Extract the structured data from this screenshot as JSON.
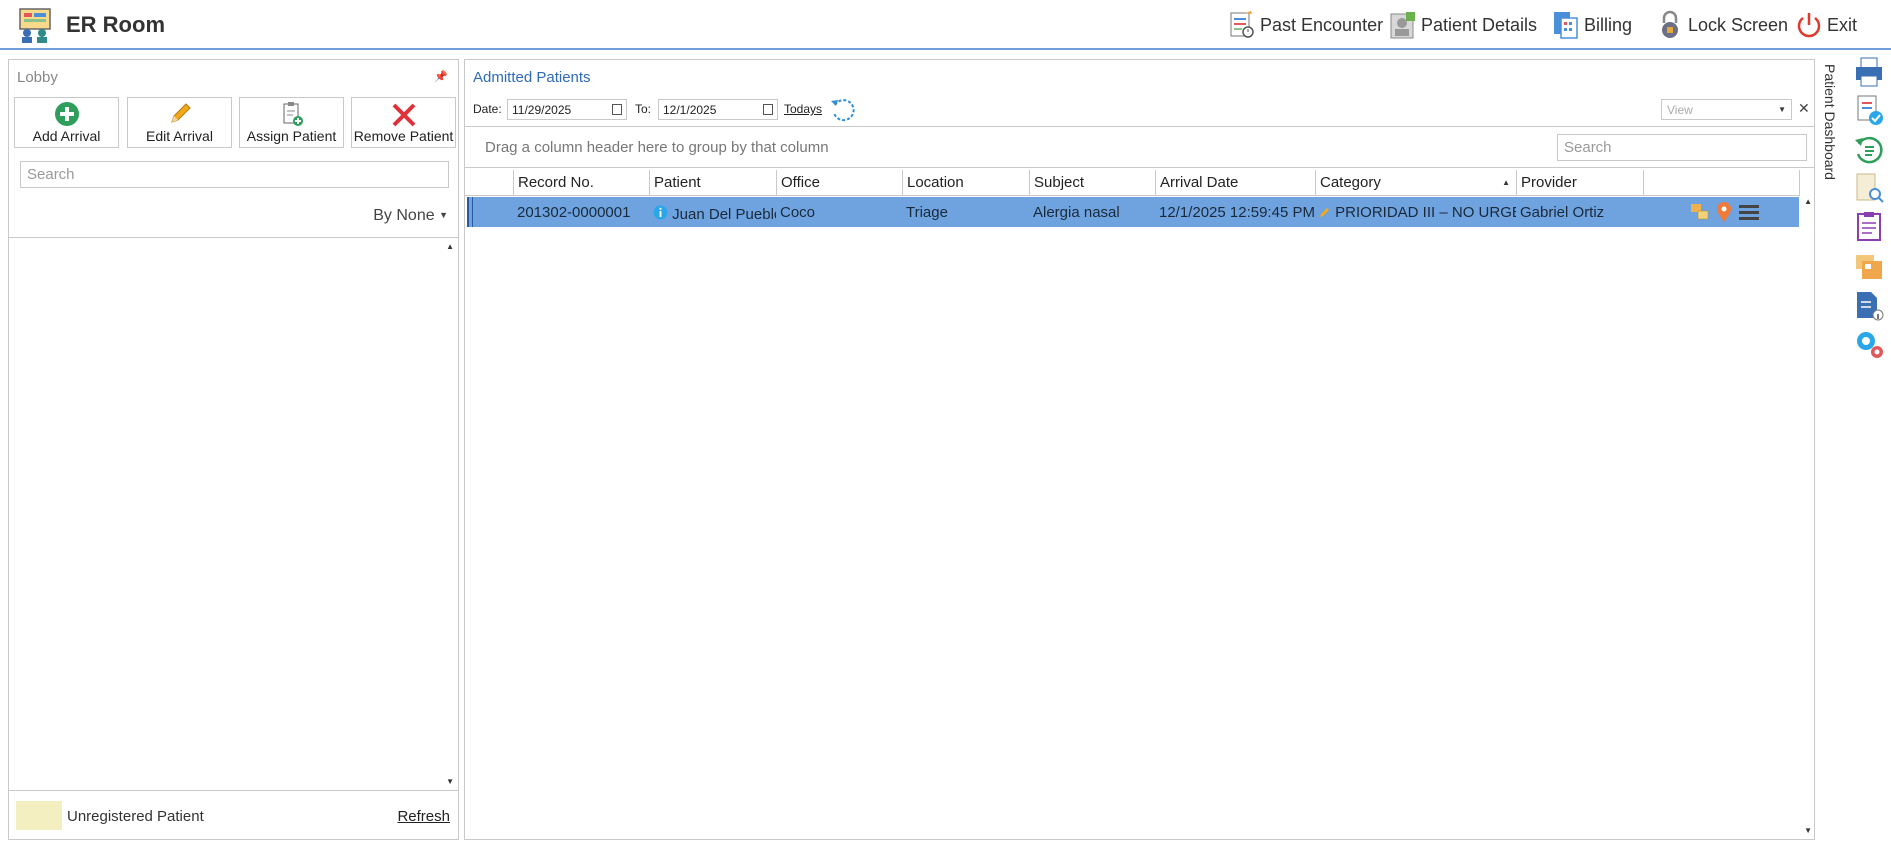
{
  "app": {
    "title": "ER Room"
  },
  "toolbar": {
    "past_encounter": "Past Encounter",
    "patient_details": "Patient Details",
    "billing": "Billing",
    "lock_screen": "Lock Screen",
    "exit": "Exit"
  },
  "lobby": {
    "title": "Lobby",
    "buttons": {
      "add_arrival": "Add Arrival",
      "edit_arrival": "Edit Arrival",
      "assign_patient": "Assign Patient",
      "remove_patient": "Remove Patient"
    },
    "search_placeholder": "Search",
    "sort_label": "By None",
    "legend": "Unregistered Patient",
    "refresh": "Refresh"
  },
  "admitted": {
    "title": "Admitted Patients",
    "date_label": "Date:",
    "date_from": "11/29/2025",
    "to_label": "To:",
    "date_to": "12/1/2025",
    "todays": "Todays",
    "view_placeholder": "View",
    "group_hint": "Drag a column header here to group by that column",
    "search_placeholder": "Search",
    "columns": [
      "Record No.",
      "Patient",
      "Office",
      "Location",
      "Subject",
      "Arrival Date",
      "Category",
      "Provider"
    ],
    "rows": [
      {
        "record_no": "201302-0000001",
        "patient": "Juan Del Pueblo",
        "office": "Coco",
        "location": "Triage",
        "subject": "Alergia nasal",
        "arrival_date": "12/1/2025 12:59:45 PM",
        "category": "PRIORIDAD III – NO URGENTE",
        "provider": "Gabriel Ortiz"
      }
    ]
  },
  "sidebar": {
    "dashboard_tab": "Patient Dashboard"
  },
  "colors": {
    "accent_blue": "#2e6bb8",
    "selected_row": "#6fa3e0",
    "unregistered_swatch": "#f3efc0",
    "exit_red": "#e03a2e"
  },
  "icons": [
    "app-icon",
    "past-encounter-icon",
    "patient-details-icon",
    "billing-icon",
    "lock-icon",
    "power-icon",
    "add-icon",
    "pencil-icon",
    "assign-icon",
    "remove-x-icon",
    "refresh-icon",
    "calendar-icon",
    "info-icon",
    "printer-icon",
    "checklist-icon",
    "history-icon",
    "document-search-icon",
    "clipboard-icon",
    "folder-icon",
    "document-info-icon",
    "settings-gears-icon"
  ]
}
